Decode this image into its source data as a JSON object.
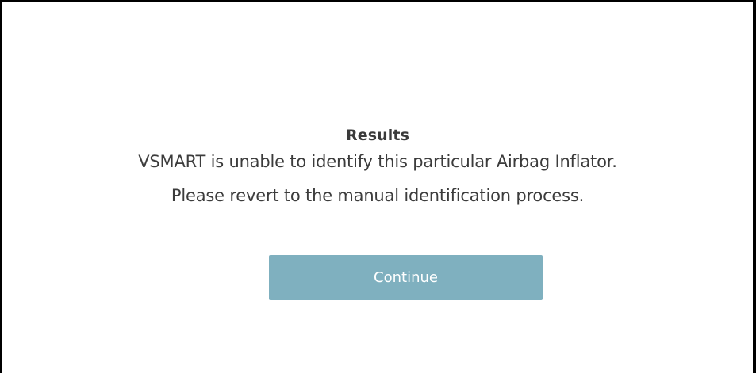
{
  "dialog": {
    "title": "Results",
    "message_line_1": "VSMART is unable to identify this particular Airbag Inflator.",
    "message_line_2": "Please revert to the manual identification process.",
    "continue_label": "Continue"
  },
  "colors": {
    "button_background": "#7fb0bf",
    "button_text": "#ffffff",
    "text": "#3c3c3c",
    "frame_border": "#000000",
    "background": "#ffffff"
  }
}
